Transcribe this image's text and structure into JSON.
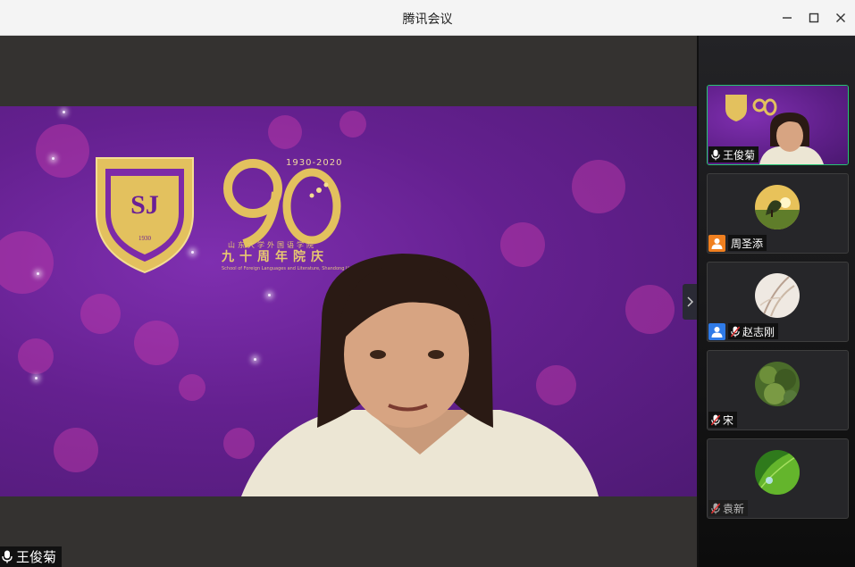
{
  "window": {
    "title": "腾讯会议"
  },
  "main_video": {
    "speaker_name": "王俊菊",
    "logo": {
      "year_range": "1930-2020",
      "cn_school": "山东大学外国语学院",
      "cn_anniversary": "九十周年院庆",
      "en_school": "School of Foreign Languages and Literature, Shandong University"
    }
  },
  "participants": [
    {
      "name": "王俊菊",
      "mic": "on",
      "has_video": true,
      "active": true
    },
    {
      "name": "周圣添",
      "mic": "none",
      "avatar_color": "#f08020",
      "has_video": false
    },
    {
      "name": "赵志刚",
      "mic": "muted",
      "avatar_color": "#2f7be8",
      "has_video": false
    },
    {
      "name": "宋",
      "mic": "muted",
      "has_video": false
    },
    {
      "name": "袁新",
      "mic": "muted",
      "has_video": false
    }
  ],
  "colors": {
    "accent_green": "#27c474",
    "muted_red": "#e03030",
    "purple_bg": "#64208f"
  }
}
